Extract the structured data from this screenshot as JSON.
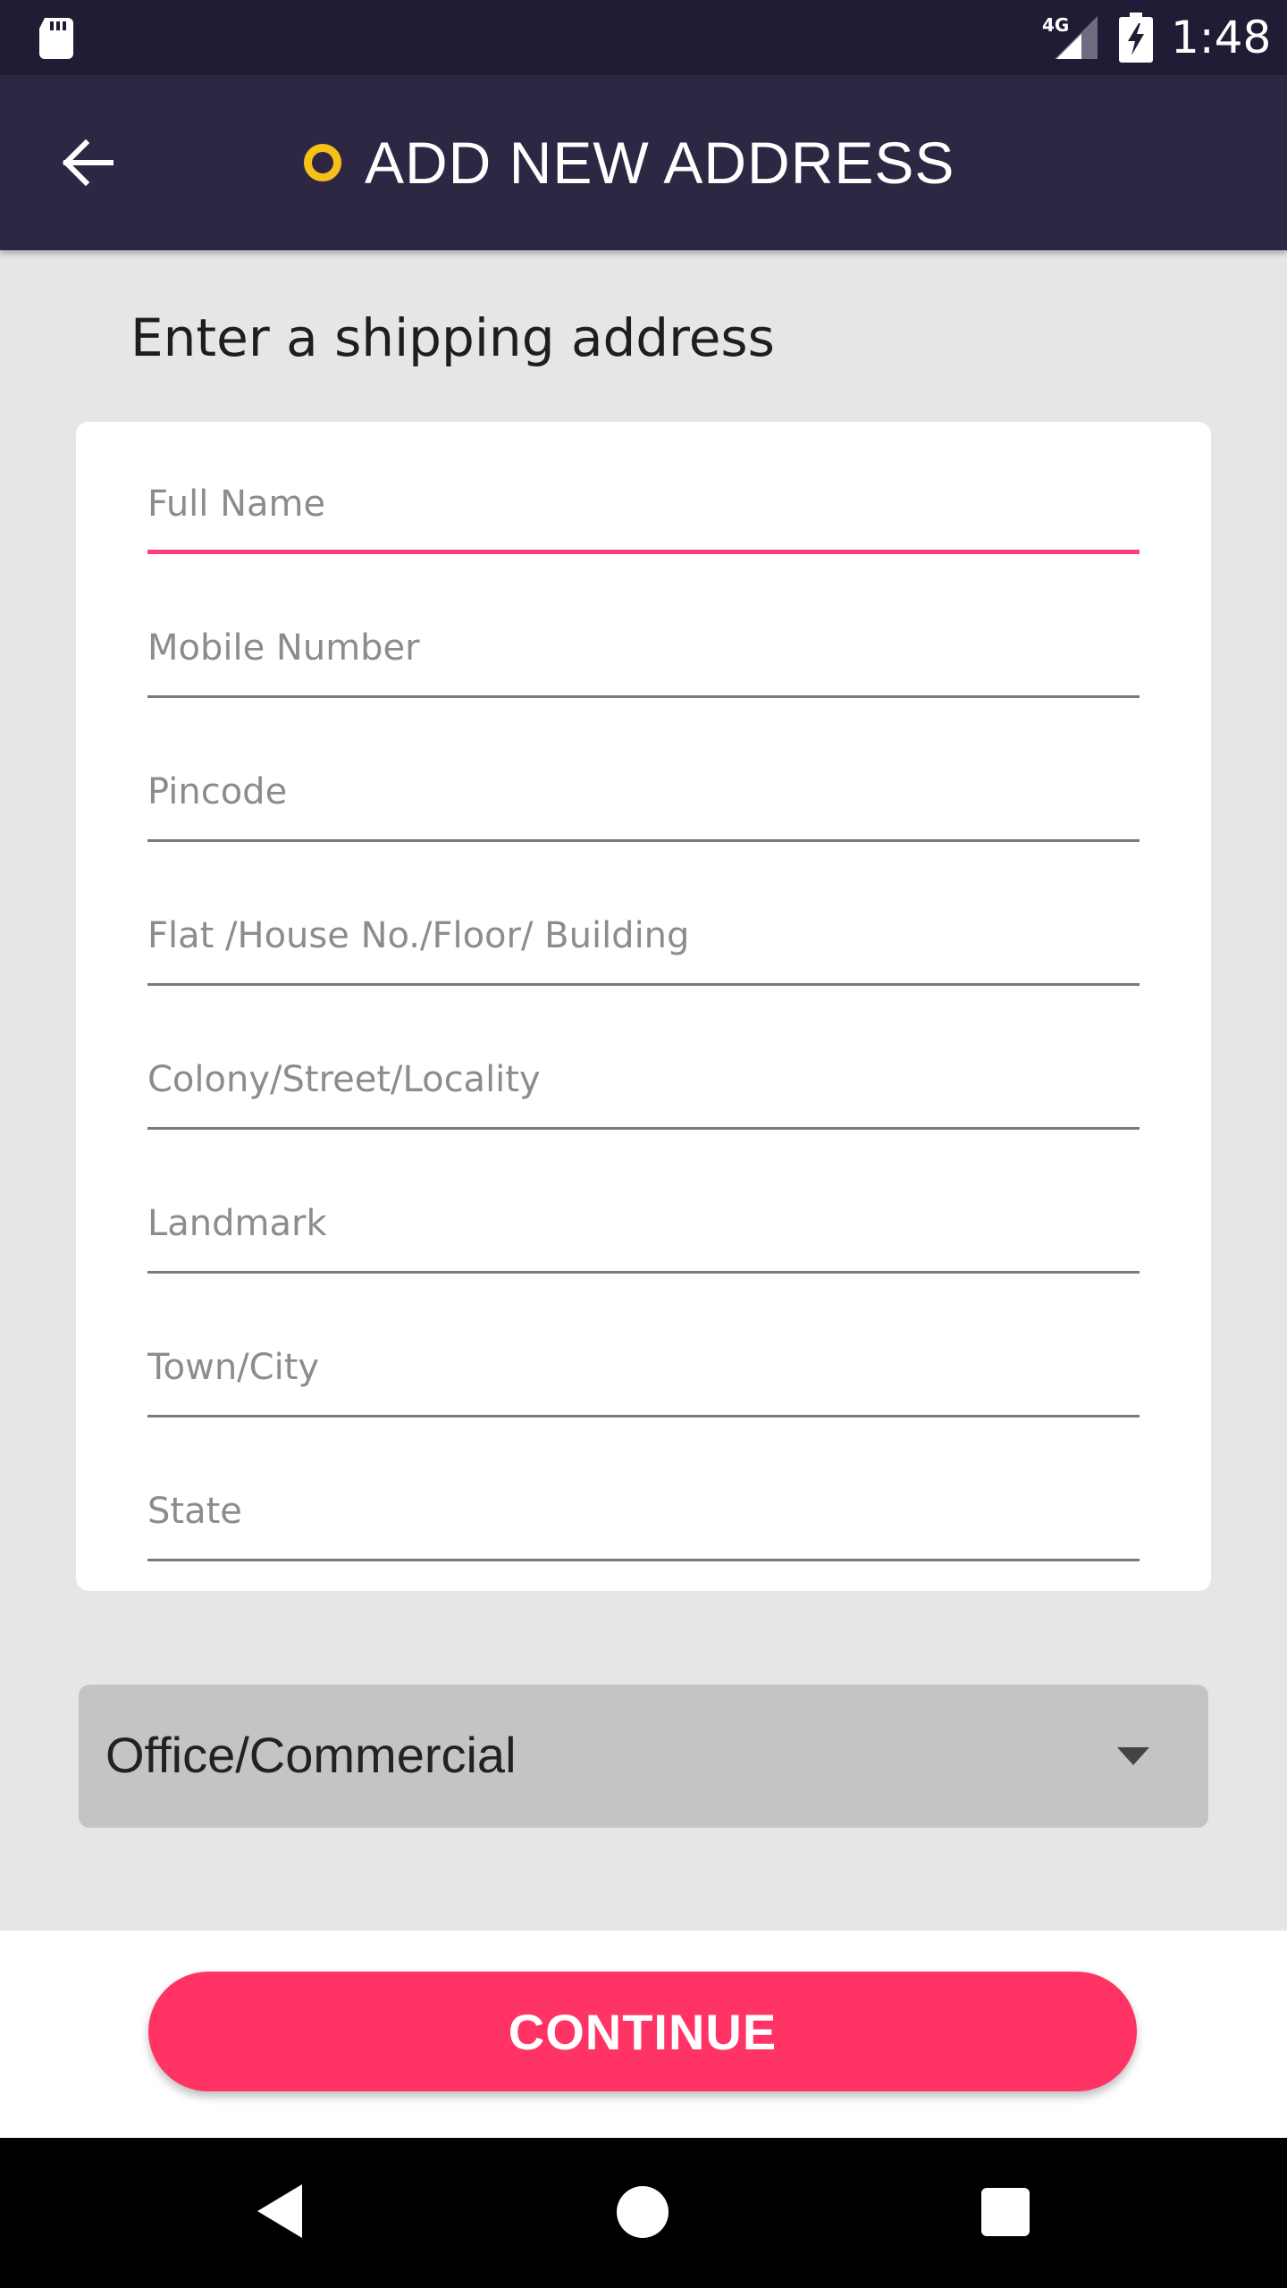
{
  "status_bar": {
    "network_label": "4G",
    "time": "1:48",
    "icons": [
      "sd-card-icon",
      "cell-signal-icon",
      "battery-charging-icon"
    ]
  },
  "app_bar": {
    "back_icon": "arrow-left-icon",
    "title_icon": "circle-outline-icon",
    "title": "ADD NEW ADDRESS"
  },
  "form": {
    "heading": "Enter a shipping address",
    "fields": [
      {
        "placeholder": "Full Name",
        "value": "",
        "focused": true
      },
      {
        "placeholder": "Mobile Number",
        "value": ""
      },
      {
        "placeholder": "Pincode",
        "value": ""
      },
      {
        "placeholder": "Flat /House No./Floor/ Building",
        "value": ""
      },
      {
        "placeholder": "Colony/Street/Locality",
        "value": ""
      },
      {
        "placeholder": "Landmark",
        "value": ""
      },
      {
        "placeholder": "Town/City",
        "value": ""
      },
      {
        "placeholder": "State",
        "value": ""
      }
    ],
    "address_type": {
      "selected": "Office/Commercial"
    }
  },
  "actions": {
    "continue_label": "CONTINUE"
  },
  "nav_bar": {
    "icons": [
      "back-triangle-icon",
      "home-circle-icon",
      "recents-square-icon"
    ]
  },
  "colors": {
    "status_bar_bg": "#1f1c35",
    "app_bar_bg": "#2d2744",
    "accent_yellow": "#f7c11a",
    "focus_pink": "#ff3e7c",
    "button_pink": "#ff3465",
    "page_bg": "#e6e6e6"
  }
}
